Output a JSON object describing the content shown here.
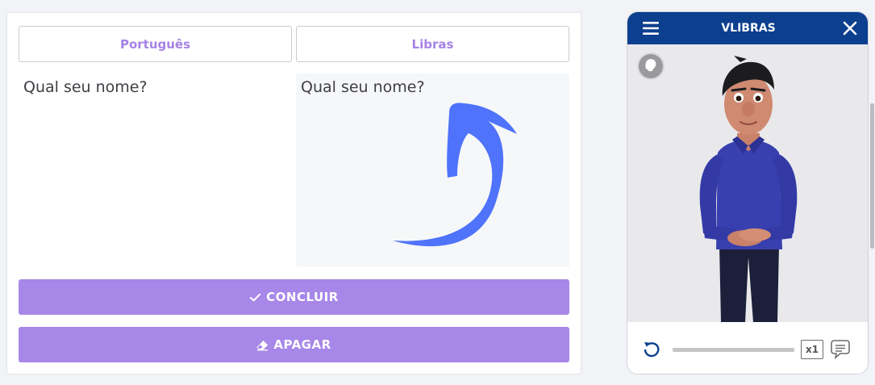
{
  "tabs": {
    "portugues": "Português",
    "libras": "Libras"
  },
  "input": {
    "portugues_text": "Qual seu nome?",
    "libras_text": "Qual seu nome?"
  },
  "buttons": {
    "concluir": "CONCLUIR",
    "apagar": "APAGAR"
  },
  "vlibras": {
    "title": "VLIBRAS",
    "speed": "x1",
    "progress": 1.0
  },
  "colors": {
    "accent": "#a787e8",
    "tab_text": "#a682e6",
    "header": "#0d3f8f",
    "arrow": "#4f73fa"
  },
  "icons": {
    "concluir": "check-icon",
    "apagar": "eraser-icon",
    "arrow": "curved-arrow-icon",
    "menu": "hamburger-menu-icon",
    "close": "close-icon",
    "brand": "vlibras-logo-icon",
    "replay": "replay-icon",
    "subtitles": "subtitles-icon"
  }
}
